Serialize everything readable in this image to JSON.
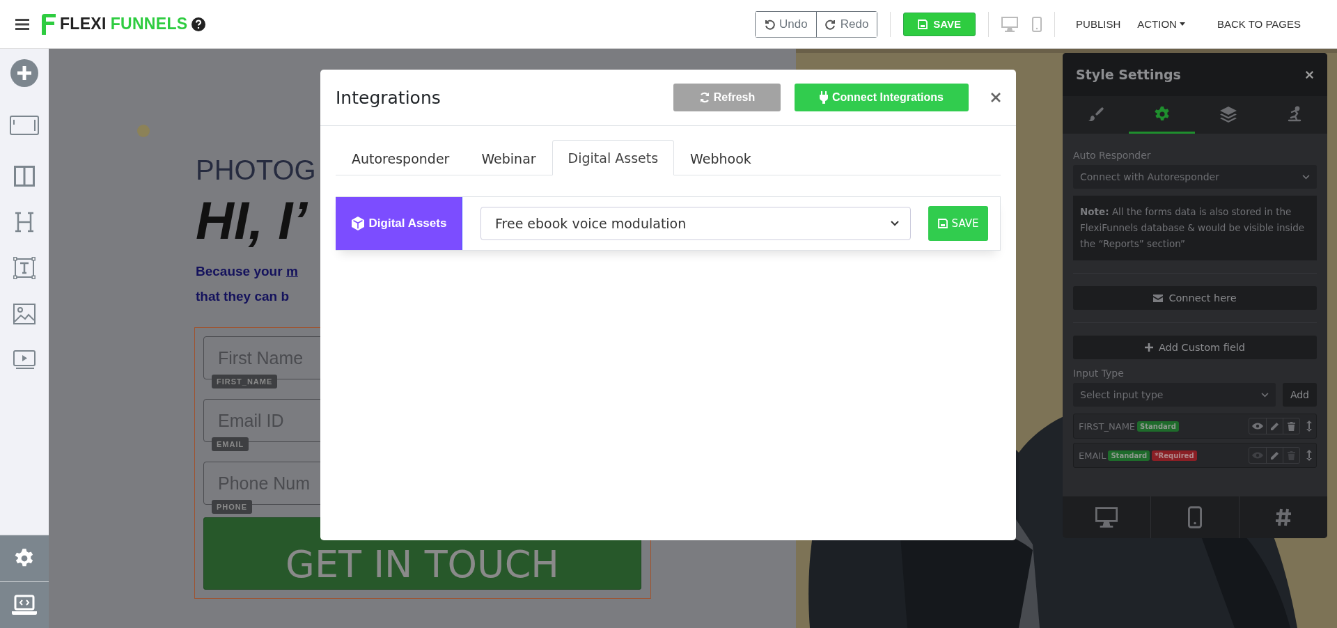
{
  "topbar": {
    "logo_words": [
      "FLEXI",
      "FUNNELS"
    ],
    "undo": "Undo",
    "redo": "Redo",
    "save": "SAVE",
    "menu": [
      {
        "label": "PUBLISH",
        "dropdown": false
      },
      {
        "label": "ACTION",
        "dropdown": true
      },
      {
        "label": "BACK TO PAGES",
        "dropdown": false
      }
    ]
  },
  "canvas": {
    "eyebrow": "PHOTOG",
    "headline": "HI, I’",
    "text_lines": [
      {
        "text": "Because your ",
        "link": "m"
      },
      {
        "text": "that they can b"
      }
    ],
    "form": {
      "fields": [
        {
          "placeholder": "First Name",
          "tag": "FIRST_NAME"
        },
        {
          "placeholder": "Email ID",
          "tag": "EMAIL"
        },
        {
          "placeholder": "Phone Num",
          "tag": "PHONE"
        }
      ],
      "button": "GET IN TOUCH"
    }
  },
  "modal": {
    "title": "Integrations",
    "refresh": "Refresh",
    "connect": "Connect Integrations",
    "tabs": [
      {
        "label": "Autoresponder",
        "selected": false
      },
      {
        "label": "Webinar",
        "selected": false
      },
      {
        "label": "Digital Assets",
        "selected": true
      },
      {
        "label": "Webhook",
        "selected": false
      }
    ],
    "panel": {
      "label": "Digital Assets",
      "select_value": "Free ebook voice modulation",
      "save": "SAVE"
    }
  },
  "style_settings": {
    "title": "Style Settings",
    "tabs": [
      {
        "kind": "brush",
        "selected": false
      },
      {
        "kind": "gear",
        "selected": true
      },
      {
        "kind": "layers",
        "selected": false
      },
      {
        "kind": "figure",
        "selected": false
      }
    ],
    "auto_responder_label": "Auto Responder",
    "auto_responder_select": "Connect with Autoresponder",
    "note": "**Note:** All the forms data is also stored in the FlexiFunnels database & would be visible inside the “Reports” section”",
    "connect_button": "Connect here",
    "add_field_button": "Add Custom field",
    "input_type_label": "Input Type",
    "input_type_placeholder": "Select input type",
    "add_button": "Add",
    "fields": [
      {
        "name": "FIRST_NAME",
        "tags": [
          {
            "text": "Standard",
            "kind": "standard"
          }
        ],
        "view_disabled": false,
        "delete_disabled": false
      },
      {
        "name": "EMAIL",
        "tags": [
          {
            "text": "Standard",
            "kind": "standard"
          },
          {
            "text": "*Required",
            "kind": "required"
          }
        ],
        "view_disabled": true,
        "delete_disabled": true
      }
    ]
  }
}
